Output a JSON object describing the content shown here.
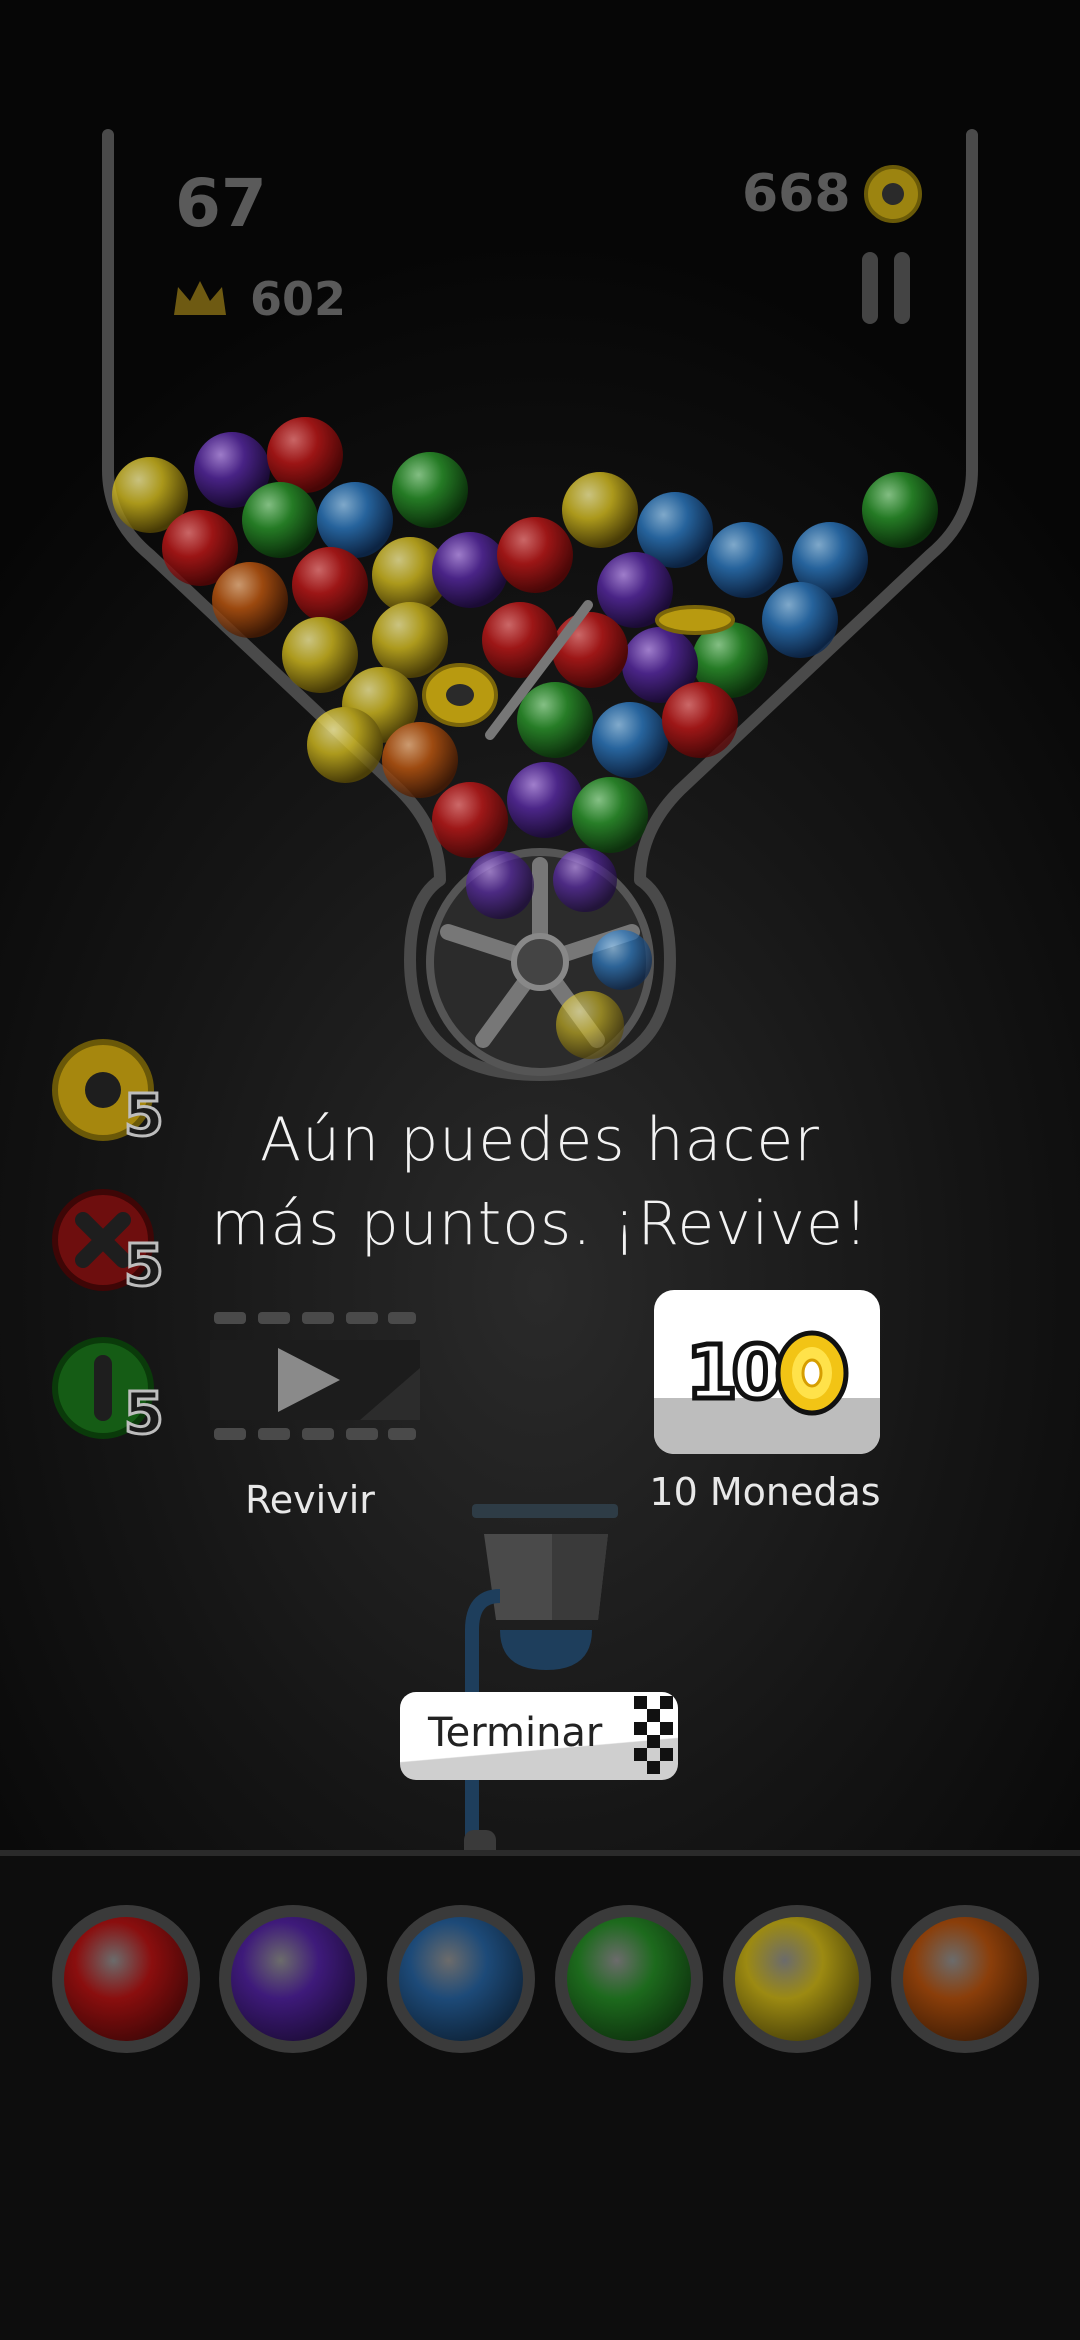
{
  "hud": {
    "score": "67",
    "best_score": "602",
    "coins": "668"
  },
  "powerups": [
    {
      "name": "coin-ring",
      "count": "5",
      "color": "#c9a30f"
    },
    {
      "name": "cross",
      "count": "5",
      "color": "#b31414"
    },
    {
      "name": "pill",
      "count": "5",
      "color": "#1f8a1f"
    }
  ],
  "revive_dialog": {
    "message_line1": "Aún puedes hacer",
    "message_line2": "más puntos. ¡Revive!",
    "video_option_label": "Revivir",
    "coin_option_amount": "10",
    "coin_option_label": "10 Monedas",
    "end_button_label": "Terminar"
  },
  "color_slots": [
    {
      "name": "red",
      "color": "#8a0e0e"
    },
    {
      "name": "purple",
      "color": "#3e1a7a"
    },
    {
      "name": "blue",
      "color": "#1d4a78"
    },
    {
      "name": "green",
      "color": "#1d6a1d"
    },
    {
      "name": "yellow",
      "color": "#9c8a12"
    },
    {
      "name": "orange",
      "color": "#8a3e0a"
    }
  ]
}
